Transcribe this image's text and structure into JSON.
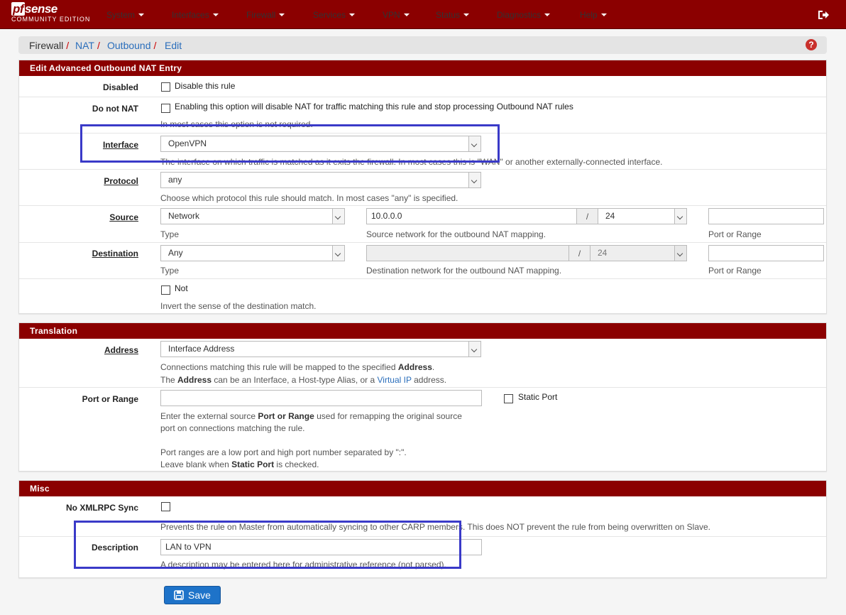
{
  "header": {
    "brand": "sense",
    "brand_prefix": "pf",
    "edition": "COMMUNITY EDITION",
    "menu": [
      "System",
      "Interfaces",
      "Firewall",
      "Services",
      "VPN",
      "Status",
      "Diagnostics",
      "Help"
    ],
    "logout_icon": "sign-out-icon"
  },
  "breadcrumb": {
    "items": [
      "Firewall",
      "NAT",
      "Outbound",
      "Edit"
    ],
    "help_icon": "question-icon"
  },
  "panel_main": {
    "title": "Edit Advanced Outbound NAT Entry",
    "disabled": {
      "label": "Disabled",
      "checkbox_label": "Disable this rule",
      "checked": false
    },
    "donotnat": {
      "label": "Do not NAT",
      "checkbox_label": "Enabling this option will disable NAT for traffic matching this rule and stop processing Outbound NAT rules",
      "help": "In most cases this option is not required.",
      "checked": false
    },
    "interface": {
      "label": "Interface",
      "value": "OpenVPN",
      "help": "The interface on which traffic is matched as it exits the firewall. In most cases this is \"WAN\" or another externally-connected interface."
    },
    "protocol": {
      "label": "Protocol",
      "value": "any",
      "help": "Choose which protocol this rule should match. In most cases \"any\" is specified."
    },
    "source": {
      "label": "Source",
      "type_value": "Network",
      "type_help": "Type",
      "network": "10.0.0.0",
      "slash": "/",
      "mask": "24",
      "network_help": "Source network for the outbound NAT mapping.",
      "port": "",
      "port_help": "Port or Range"
    },
    "destination": {
      "label": "Destination",
      "type_value": "Any",
      "type_help": "Type",
      "network": "",
      "slash": "/",
      "mask": "24",
      "network_help": "Destination network for the outbound NAT mapping.",
      "port": "",
      "port_help": "Port or Range"
    },
    "not": {
      "checkbox_label": "Not",
      "help": "Invert the sense of the destination match.",
      "checked": false
    }
  },
  "panel_translation": {
    "title": "Translation",
    "address": {
      "label": "Address",
      "value": "Interface Address",
      "help1_pre": "Connections matching this rule will be mapped to the specified ",
      "help1_bold": "Address",
      "help1_post": ".",
      "help2_pre": "The ",
      "help2_bold": "Address",
      "help2_mid": " can be an Interface, a Host-type Alias, or a ",
      "help2_link": "Virtual IP",
      "help2_post": " address."
    },
    "port": {
      "label": "Port or Range",
      "value": "",
      "static_label": "Static Port",
      "static_checked": false,
      "help1_pre": "Enter the external source ",
      "help1_bold": "Port or Range",
      "help1_post": " used for remapping the original source",
      "help2": "port on connections matching the rule.",
      "help3": "Port ranges are a low port and high port number separated by \":\".",
      "help4_pre": "Leave blank when ",
      "help4_bold": "Static Port",
      "help4_post": " is checked."
    }
  },
  "panel_misc": {
    "title": "Misc",
    "noxmlrpc": {
      "label": "No XMLRPC Sync",
      "checked": false,
      "help": "Prevents the rule on Master from automatically syncing to other CARP members. This does NOT prevent the rule from being overwritten on Slave."
    },
    "description": {
      "label": "Description",
      "value": "LAN to VPN",
      "help": "A description may be entered here for administrative reference (not parsed)."
    }
  },
  "save": {
    "label": "Save",
    "icon": "save-icon"
  },
  "colors": {
    "brand": "#8b0000",
    "highlight": "#3a3ac8",
    "link": "#2a6ebb",
    "button": "#1e73c9"
  }
}
